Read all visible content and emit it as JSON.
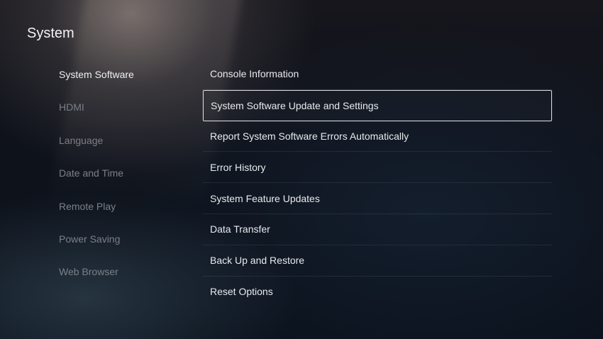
{
  "header": {
    "title": "System"
  },
  "sidebar": {
    "items": [
      {
        "label": "System Software",
        "active": true
      },
      {
        "label": "HDMI",
        "active": false
      },
      {
        "label": "Language",
        "active": false
      },
      {
        "label": "Date and Time",
        "active": false
      },
      {
        "label": "Remote Play",
        "active": false
      },
      {
        "label": "Power Saving",
        "active": false
      },
      {
        "label": "Web Browser",
        "active": false
      }
    ]
  },
  "main": {
    "items": [
      {
        "label": "Console Information"
      },
      {
        "label": "System Software Update and Settings",
        "focused": true
      },
      {
        "label": "Report System Software Errors Automatically"
      },
      {
        "label": "Error History"
      },
      {
        "label": "System Feature Updates"
      },
      {
        "label": "Data Transfer"
      },
      {
        "label": "Back Up and Restore"
      },
      {
        "label": "Reset Options"
      }
    ]
  },
  "colors": {
    "background": "#0b1019",
    "text_active": "#eef0f3",
    "text_inactive": "#7c7f88",
    "focus_border": "#d8dadf"
  }
}
